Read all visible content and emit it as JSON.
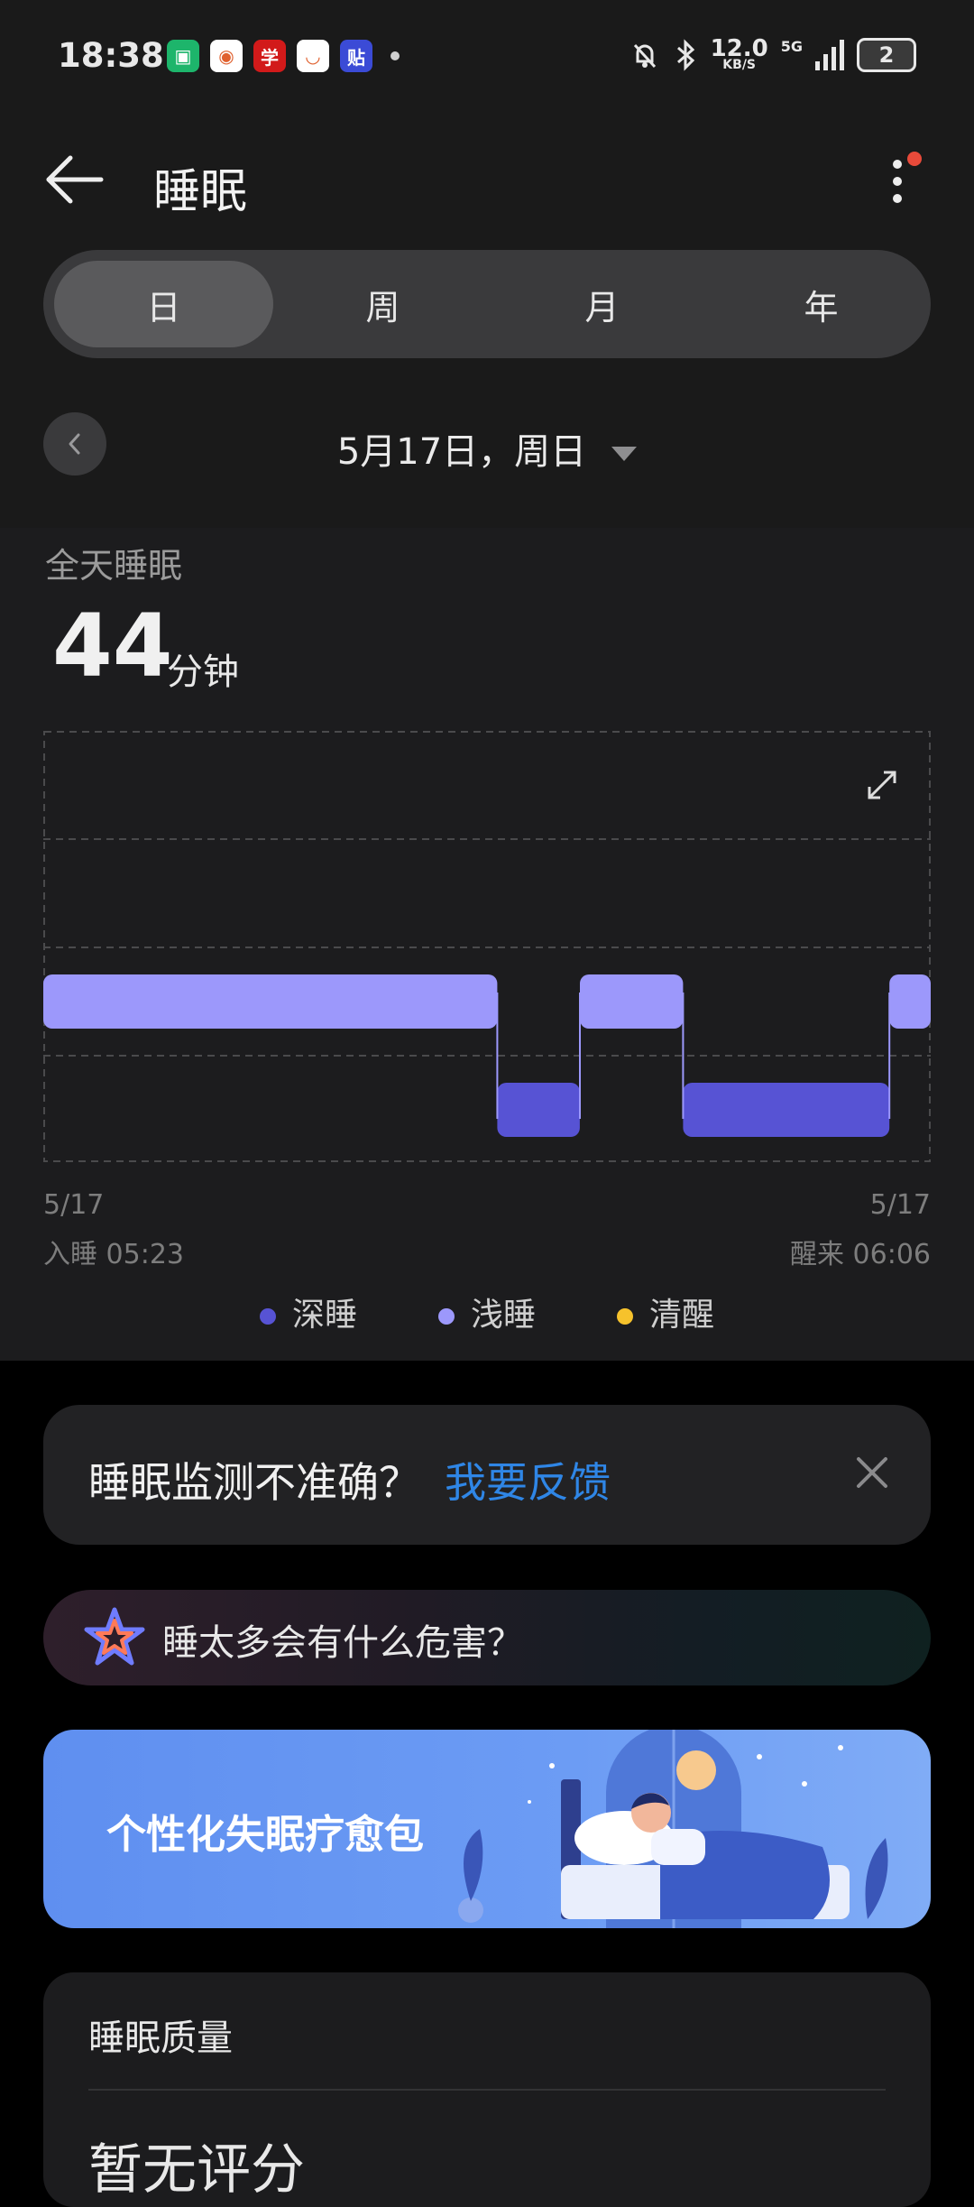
{
  "status_bar": {
    "time": "18:38",
    "speed_value": "12.0",
    "speed_unit": "KB/S",
    "network": "5G",
    "battery": "2",
    "app_icons": [
      {
        "name": "mi-home-icon",
        "glyph": "▣",
        "color": "#1db56b"
      },
      {
        "name": "gallery-icon",
        "glyph": "◉",
        "color": "#ffffff"
      },
      {
        "name": "xuexi-icon",
        "glyph": "学",
        "color": "#d21a1a"
      },
      {
        "name": "didi-icon",
        "glyph": "◡",
        "color": "#ffffff"
      },
      {
        "name": "tieba-icon",
        "glyph": "贴",
        "color": "#3b4bd6"
      }
    ]
  },
  "header": {
    "title": "睡眠"
  },
  "tabs": [
    {
      "label": "日",
      "active": true
    },
    {
      "label": "周",
      "active": false
    },
    {
      "label": "月",
      "active": false
    },
    {
      "label": "年",
      "active": false
    }
  ],
  "date": {
    "label": "5月17日，周日"
  },
  "summary": {
    "label": "全天睡眠",
    "value": "44",
    "unit": "分钟"
  },
  "chart_data": {
    "type": "hypnogram",
    "levels": [
      "清醒",
      "浅睡",
      "深睡"
    ],
    "colors": {
      "深睡": "#5753d4",
      "浅睡": "#9c98fb",
      "清醒": "#f6c22c"
    },
    "start": "05:23",
    "end": "06:06",
    "segments": [
      {
        "stage": "浅睡",
        "from": "05:23",
        "to": "05:45"
      },
      {
        "stage": "深睡",
        "from": "05:45",
        "to": "05:49"
      },
      {
        "stage": "浅睡",
        "from": "05:49",
        "to": "05:54"
      },
      {
        "stage": "深睡",
        "from": "05:54",
        "to": "06:04"
      },
      {
        "stage": "浅睡",
        "from": "06:04",
        "to": "06:06"
      }
    ],
    "x_start_date": "5/17",
    "x_end_date": "5/17",
    "x_start_label": "入睡 05:23",
    "x_end_label": "醒来 06:06",
    "legend": [
      "深睡",
      "浅睡",
      "清醒"
    ]
  },
  "feedback": {
    "question": "睡眠监测不准确？",
    "link": "我要反馈"
  },
  "ai_prompt": {
    "text": "睡太多会有什么危害？"
  },
  "banner": {
    "text": "个性化失眠疗愈包"
  },
  "quality": {
    "title": "睡眠质量",
    "value": "暂无评分"
  }
}
